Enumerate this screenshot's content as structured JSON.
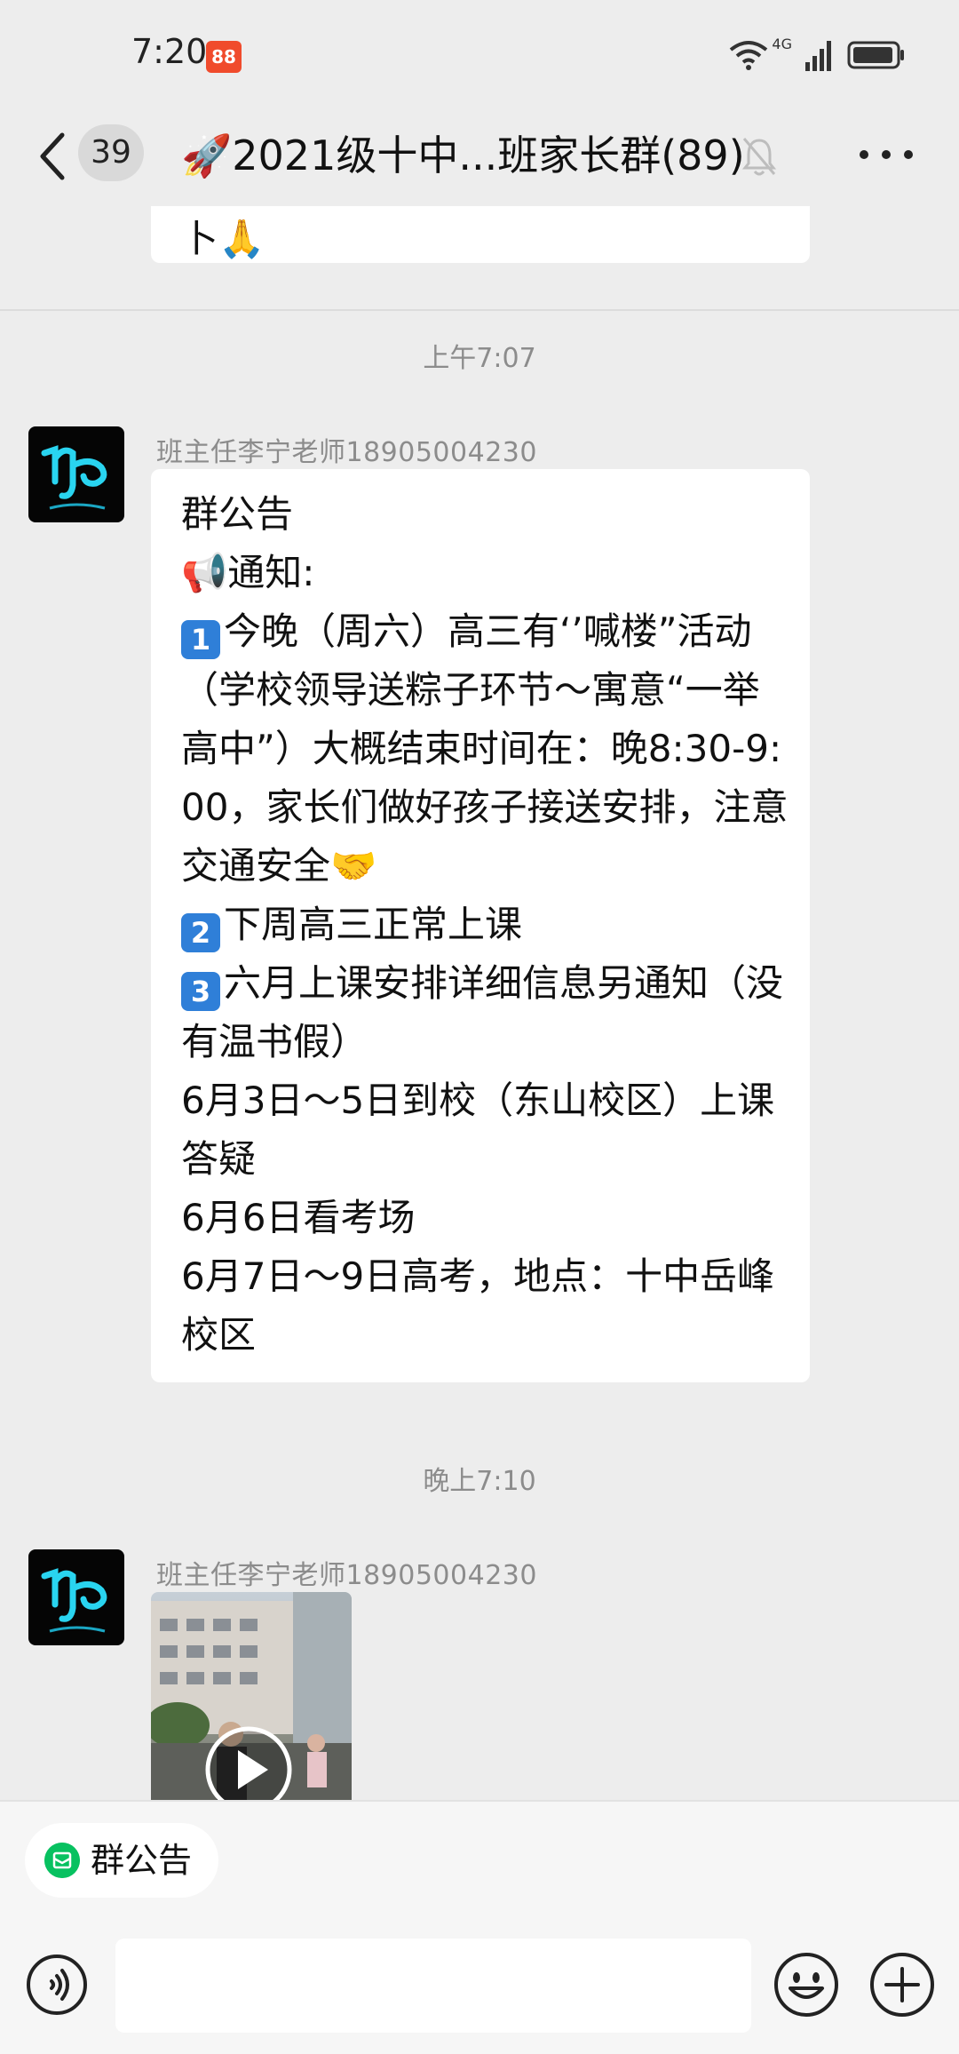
{
  "status_bar": {
    "time": "7:20",
    "app_icon_text": "88",
    "network_label": "4G"
  },
  "header": {
    "unread_count": "39",
    "title": "🚀2021级十中...班家长群(89)"
  },
  "messages": {
    "prev_partial_text": "卜🙏",
    "timestamp_1": "上午7:07",
    "sender_1": "班主任李宁老师18905004230",
    "announcement_lines": [
      "群公告",
      "📢通知:",
      "今晚（周六）高三有‘’喊楼”活动（学校领导送粽子环节～寓意“一举高中”）大概结束时间在：晚8:30-9:00，家长们做好孩子接送安排，注意交通安全🤝",
      "下周高三正常上课",
      "六月上课安排详细信息另通知（没有温书假）",
      "6月3日～5日到校（东山校区）上课答疑",
      "6月6日看考场",
      "6月7日～9日高考，地点：十中岳峰校区"
    ],
    "keycap_1": "1",
    "keycap_2": "2",
    "keycap_3": "3",
    "timestamp_2": "晚上7:10",
    "sender_2": "班主任李宁老师18905004230"
  },
  "bottom_bar": {
    "notice_chip_label": "群公告",
    "input_value": ""
  },
  "colors": {
    "background": "#ededed",
    "bubble": "#ffffff",
    "accent_green": "#07c160",
    "meta_text": "#8c8c8c"
  },
  "icons": [
    "back-arrow-icon",
    "mute-bell-icon",
    "more-dots-icon",
    "play-icon",
    "voice-icon",
    "emoji-icon",
    "plus-icon",
    "notice-icon",
    "wifi-icon",
    "signal-icon",
    "battery-icon"
  ]
}
